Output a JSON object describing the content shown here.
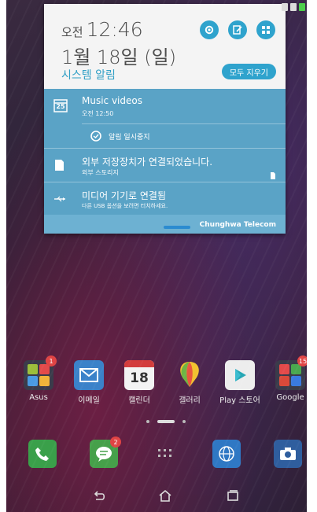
{
  "status_bar": {
    "icons": [
      "sim-icon",
      "signal-icon",
      "battery-icon"
    ]
  },
  "notification_shade": {
    "ampm": "오전",
    "time": "12:46",
    "date": "1월 18일 (일)",
    "section_label": "시스템 알림",
    "clear_all": "모두 지우기",
    "quick_settings": [
      "settings-icon",
      "edit-icon",
      "apps-grid-icon"
    ],
    "notifications": [
      {
        "title": "Music videos",
        "sub": "오전 12:50",
        "icon": "calendar-icon",
        "icon_text": "25"
      },
      {
        "title": "알림 일시중지",
        "icon": "alarm-icon"
      },
      {
        "title": "외부 저장장치가 연결되었습니다.",
        "sub": "외부 스토리지",
        "icon": "sdcard-icon"
      },
      {
        "title": "미디어 기기로 연결됨",
        "sub": "다른 USB 옵션을 보려면 터치하세요.",
        "icon": "usb-icon"
      }
    ],
    "carrier": "Chunghwa Telecom"
  },
  "home_screen": {
    "apps": [
      {
        "label": "Asus",
        "badge": "1"
      },
      {
        "label": "이메일"
      },
      {
        "label": "캘린더",
        "icon_text": "18"
      },
      {
        "label": "갤러리"
      },
      {
        "label": "Play 스토어"
      },
      {
        "label": "Google",
        "badge": "15"
      }
    ],
    "dock": [
      "phone-icon",
      "messages-icon",
      "app-drawer-icon",
      "browser-icon",
      "camera-icon"
    ],
    "dock_badge": "2"
  },
  "navbar": {
    "buttons": [
      "back-icon",
      "home-icon",
      "recents-icon"
    ]
  },
  "colors": {
    "accent": "#2fa3cd",
    "shade_bg": "#5aa3c6",
    "header_bg": "#f4f4f4"
  }
}
